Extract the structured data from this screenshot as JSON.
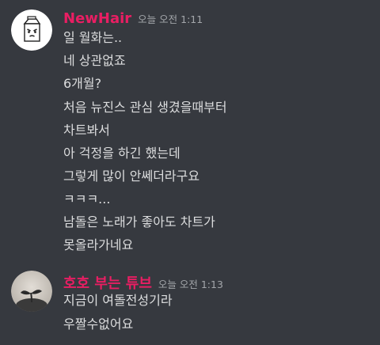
{
  "colors": {
    "background": "#36393f",
    "message_text": "#dcddde",
    "timestamp": "#a3a6aa",
    "username": "#e91e63"
  },
  "messages": [
    {
      "username": "NewHair",
      "timestamp": "오늘 오전 1:11",
      "avatar_icon": "milk-carton-avatar-icon",
      "lines": [
        "일 월화는..",
        "네 상관없죠",
        "6개월?",
        "처음 뉴진스 관심 생겼을때부터",
        "차트봐서",
        "아 걱정을 하긴 했는데",
        "그렇게 많이 안쎄더라구요",
        "ㅋㅋㅋ...",
        "남돌은 노래가 좋아도 차트가",
        "못올라가네요"
      ]
    },
    {
      "username": "호호 부는 튜브",
      "timestamp": "오늘 오전 1:13",
      "avatar_icon": "plant-sprout-avatar-icon",
      "lines": [
        "지금이 여돌전성기라",
        "우짤수없어요"
      ]
    }
  ]
}
